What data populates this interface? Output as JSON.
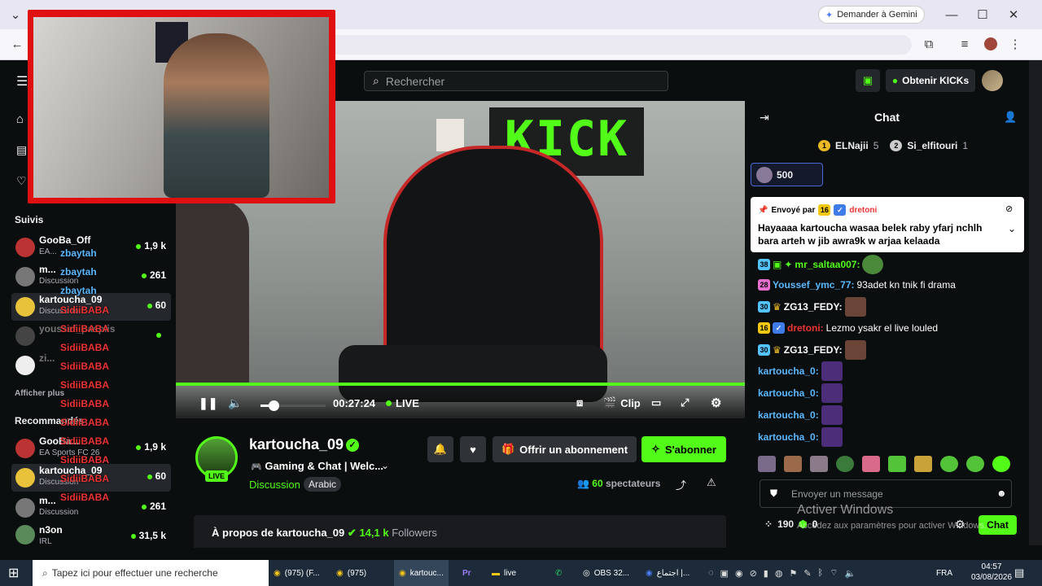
{
  "browser": {
    "gemini_label": "Demander à Gemini"
  },
  "header": {
    "search_placeholder": "Rechercher",
    "get_kicks_label": "Obtenir KICKs"
  },
  "sidebar": {
    "followed_heading": "Suivis",
    "show_more": "Afficher plus",
    "recommended_heading": "Recommandés",
    "followed": [
      {
        "name": "GooBa_Off",
        "category": "EA...",
        "viewers": "1,9 k"
      },
      {
        "name": "m...",
        "category": "Discussion",
        "viewers": "261"
      },
      {
        "name": "kartoucha_09",
        "category": "Discussion",
        "viewers": "60"
      },
      {
        "name": "youssef_pasplis",
        "category": "",
        "viewers": ""
      },
      {
        "name": "zi...",
        "category": "",
        "viewers": ""
      }
    ],
    "recommended": [
      {
        "name": "GooBa...",
        "category": "EA Sports FC 26",
        "viewers": "1,9 k"
      },
      {
        "name": "kartoucha_09",
        "category": "Discussion",
        "viewers": "60"
      },
      {
        "name": "m...",
        "category": "Discussion",
        "viewers": "261"
      },
      {
        "name": "n3on",
        "category": "IRL",
        "viewers": "31,5 k"
      }
    ],
    "overlay_names": [
      "zbaytah",
      "zbaytah",
      "zbaytah",
      "SidiiBABA",
      "SidiiBABA",
      "SidiiBABA",
      "SidiiBABA",
      "SidiiBABA",
      "SidiiBABA",
      "SidiiBABA",
      "SidiiBABA",
      "SidiiBABA",
      "SidiiBABA",
      "SidiiBABA"
    ]
  },
  "player": {
    "time": "00:27:24",
    "live_label": "LIVE",
    "clip_label": "Clip",
    "volume_fraction": 0.2,
    "wall_text": "KICK"
  },
  "channel": {
    "name": "kartoucha_09",
    "title": "Gaming & Chat | Welc...",
    "category": "Discussion",
    "tag": "Arabic",
    "live_badge": "LIVE",
    "gift_label": "Offrir un abonnement",
    "subscribe_label": "S'abonner",
    "viewers_count": "60",
    "viewers_label": "spectateurs",
    "about_prefix": "À propos de kartoucha_09",
    "followers_count": "14,1 k",
    "followers_label": "Followers"
  },
  "chat": {
    "title": "Chat",
    "leaders": [
      {
        "name": "ELNajii",
        "count": "5"
      },
      {
        "name": "Si_elfitouri",
        "count": "1"
      }
    ],
    "kick_pill": "500",
    "pinned_sender_prefix": "Envoyé par",
    "pinned_badge": "16",
    "pinned_sender": "dretoni",
    "pinned_text_1": "Hayaaaa kartoucha wasaa belek raby yfarj nchlh",
    "pinned_text_2": "bara arteh w jib awra9k w arjaa kelaada",
    "messages": [
      {
        "badge": "38",
        "user": "mr_saltaa007:",
        "text": ""
      },
      {
        "badge": "28",
        "user": "Youssef_ymc_77:",
        "text": "93adet kn tnik fi drama"
      },
      {
        "badge": "30",
        "user": "ZG13_FEDY:",
        "text": ""
      },
      {
        "badge": "16",
        "user": "dretoni:",
        "text": "Lezmo ysakr el live louled"
      },
      {
        "badge": "30",
        "user": "ZG13_FEDY:",
        "text": ""
      },
      {
        "badge": "",
        "user": "kartoucha_0:",
        "text": ""
      },
      {
        "badge": "",
        "user": "kartoucha_0:",
        "text": ""
      },
      {
        "badge": "",
        "user": "kartoucha_0:",
        "text": ""
      },
      {
        "badge": "",
        "user": "kartoucha_0:",
        "text": ""
      }
    ],
    "input_placeholder": "Envoyer un message",
    "kicks_balance": "190",
    "points_balance": "0",
    "send_label": "Chat"
  },
  "watermark": {
    "line1": "Activer Windows",
    "line2": "Accédez aux paramètres pour activer Windows."
  },
  "taskbar": {
    "search_placeholder": "Tapez ici pour effectuer une recherche",
    "items": [
      "(975) (F...",
      "(975)",
      "kartouc...",
      "live",
      "OBS 32...",
      "اجتماع |..."
    ],
    "language": "FRA",
    "time": "04:57",
    "date": "03/08/2026"
  },
  "colors": {
    "accent": "#53fc18",
    "background": "#0b0e0f",
    "panel": "#191b1f",
    "webcam_frame": "#e01010"
  }
}
